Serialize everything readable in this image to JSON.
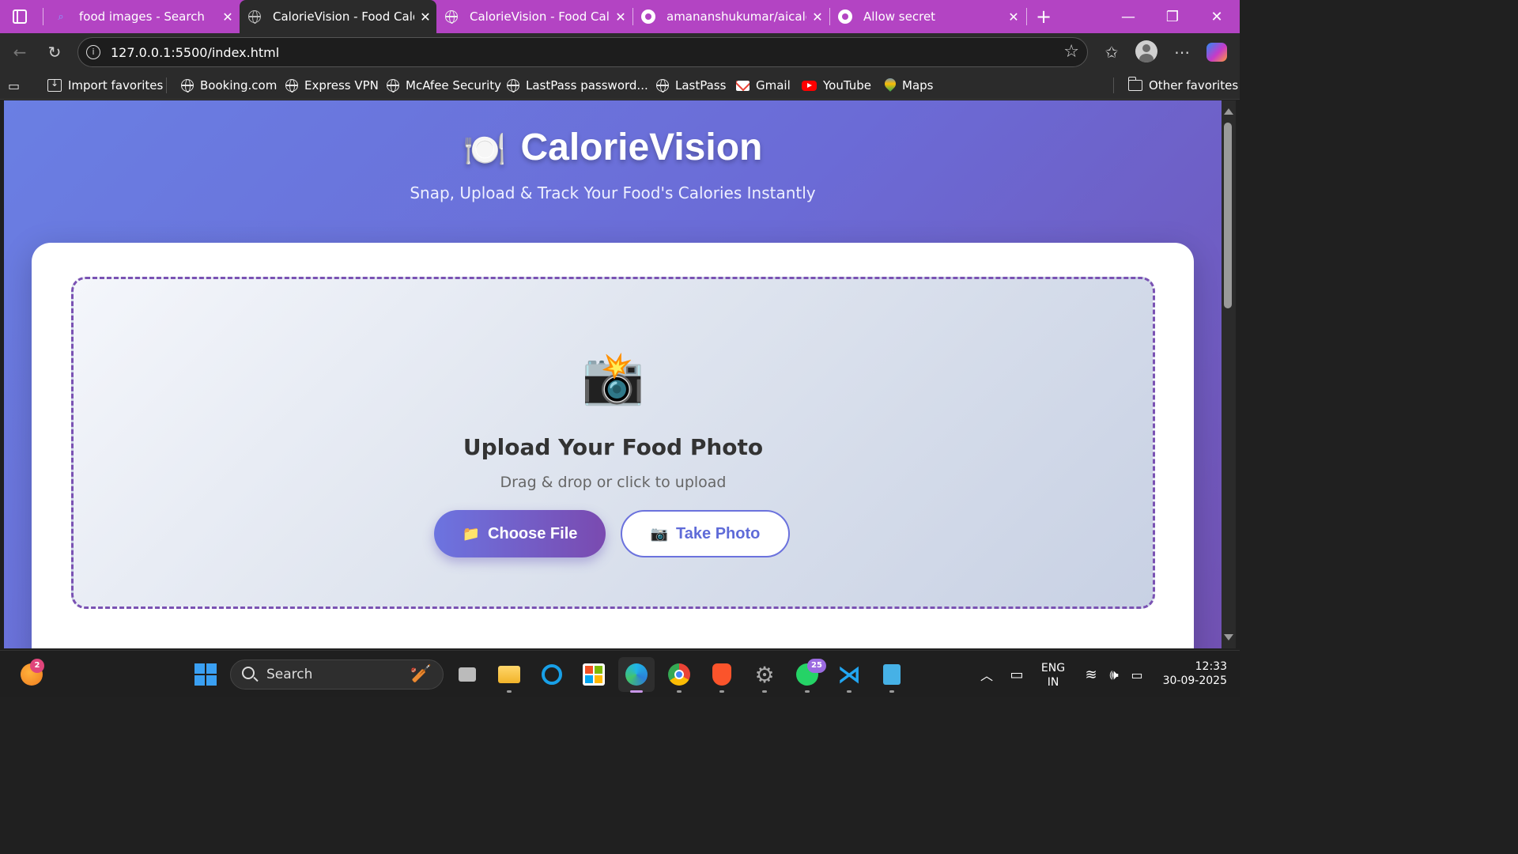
{
  "browser": {
    "tabs": [
      {
        "title": "food images - Search",
        "icon": "search-icon"
      },
      {
        "title": "CalorieVision - Food Calorie Tracker",
        "icon": "globe-icon",
        "active": true
      },
      {
        "title": "CalorieVision - Food Calorie Tracker",
        "icon": "globe-icon"
      },
      {
        "title": "amananshukumar/aicalorie",
        "icon": "github-icon"
      },
      {
        "title": "Allow secret",
        "icon": "github-icon"
      }
    ],
    "url": "127.0.0.1:5500/index.html",
    "favorites": [
      {
        "label": "Import favorites",
        "icon": "import-icon"
      },
      {
        "label": "Booking.com",
        "icon": "globe-icon"
      },
      {
        "label": "Express VPN",
        "icon": "globe-icon"
      },
      {
        "label": "McAfee Security",
        "icon": "globe-icon"
      },
      {
        "label": "LastPass password...",
        "icon": "globe-icon"
      },
      {
        "label": "LastPass",
        "icon": "globe-icon"
      },
      {
        "label": "Gmail",
        "icon": "gmail-icon"
      },
      {
        "label": "YouTube",
        "icon": "youtube-icon"
      },
      {
        "label": "Maps",
        "icon": "maps-icon"
      }
    ],
    "other_favorites": "Other favorites",
    "accent_color": "#b344c3"
  },
  "page": {
    "title": "CalorieVision",
    "title_emoji": "🍽️",
    "subtitle": "Snap, Upload & Track Your Food's Calories Instantly",
    "upload": {
      "icon": "📸",
      "heading": "Upload Your Food Photo",
      "hint": "Drag & drop or click to upload",
      "choose_file_icon": "📁",
      "choose_file_label": "Choose File",
      "take_photo_icon": "📷",
      "take_photo_label": "Take Photo"
    },
    "colors": {
      "gradient_start": "#6a7fe3",
      "gradient_end": "#7252b4",
      "dropzone_border": "#7a52b3"
    }
  },
  "taskbar": {
    "weather_badge": "2",
    "search_placeholder": "Search",
    "whatsapp_badge": "25",
    "language": "ENG",
    "region": "IN",
    "time": "12:33",
    "date": "30-09-2025"
  }
}
